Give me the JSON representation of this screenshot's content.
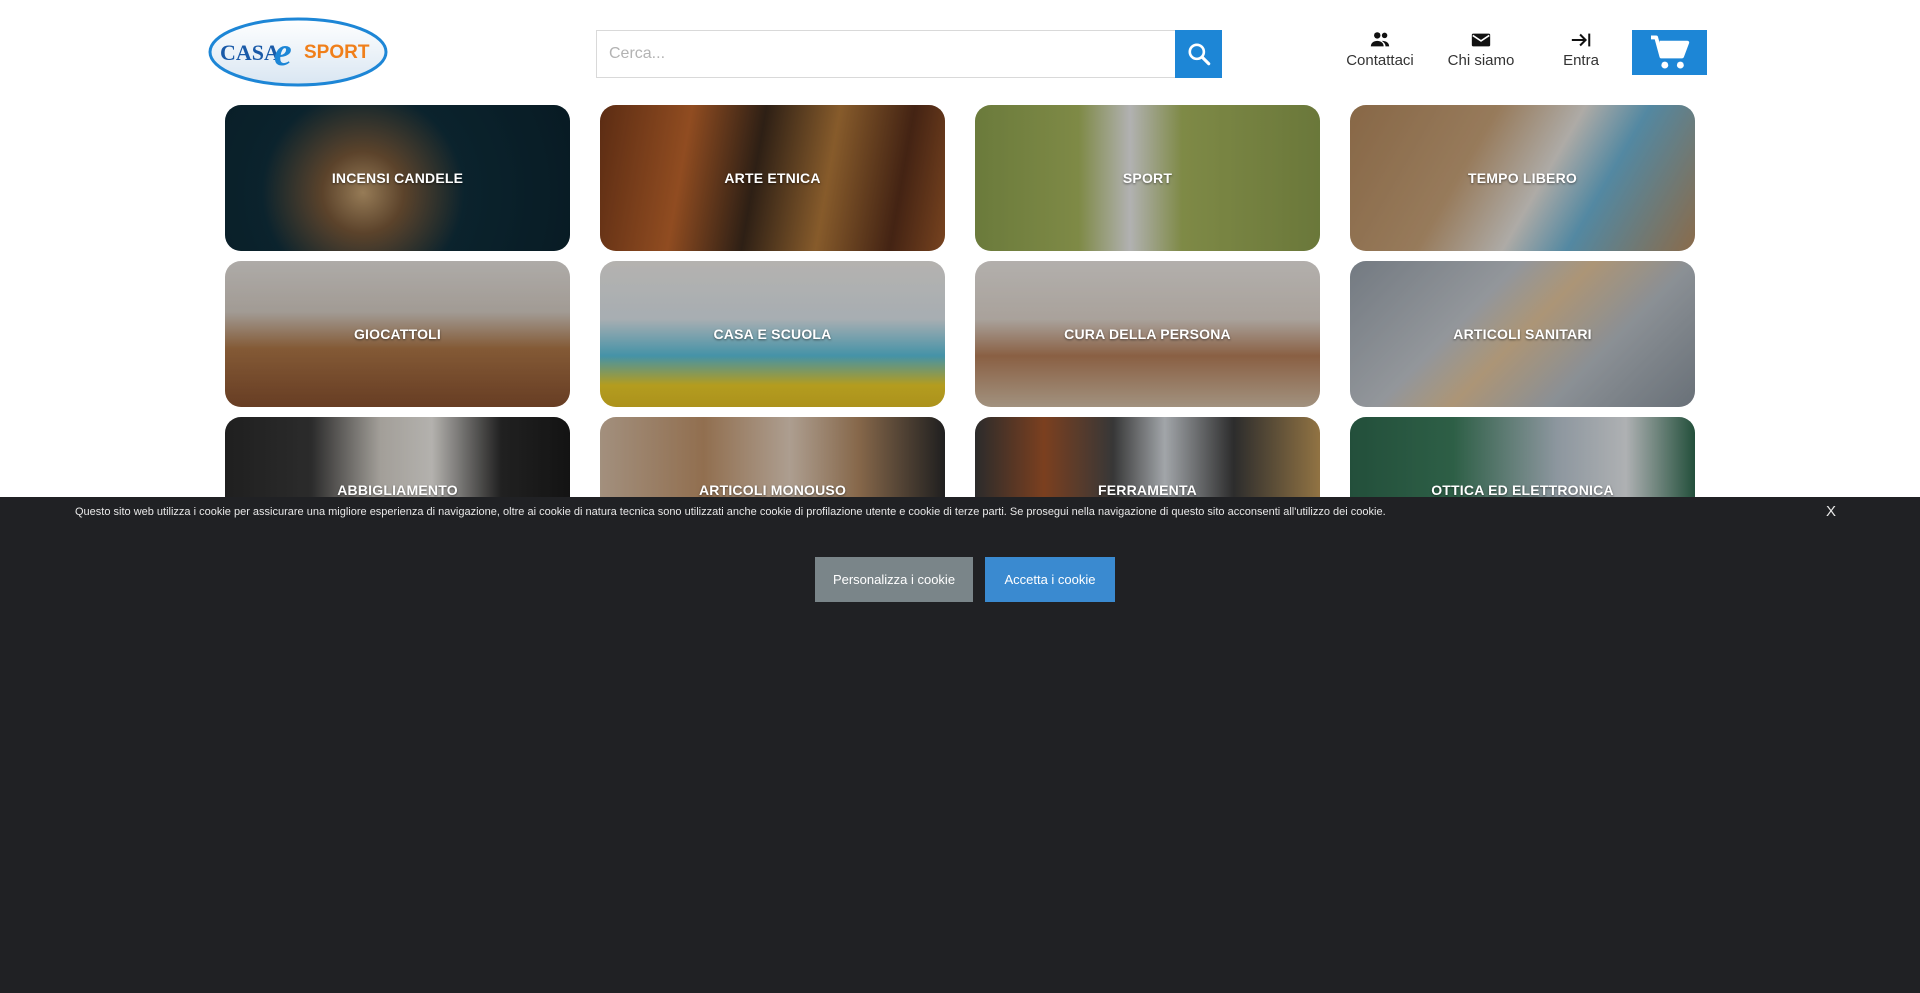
{
  "brand": {
    "logo_text_left": "CASA",
    "logo_text_mid": "e",
    "logo_text_right": "SPORT",
    "primary_color": "#1d86d6",
    "logo_orange": "#f07f1a"
  },
  "search": {
    "placeholder": "Cerca...",
    "icon": "search-icon"
  },
  "nav": {
    "contatti": "Contattaci",
    "chi_siamo": "Chi siamo",
    "entra": "Entra",
    "cart_icon": "cart-icon"
  },
  "categories": [
    {
      "label": "INCENSI CANDELE"
    },
    {
      "label": "ARTE ETNICA"
    },
    {
      "label": "SPORT"
    },
    {
      "label": "TEMPO LIBERO"
    },
    {
      "label": "GIOCATTOLI"
    },
    {
      "label": "CASA E SCUOLA"
    },
    {
      "label": "CURA DELLA PERSONA"
    },
    {
      "label": "ARTICOLI SANITARI"
    },
    {
      "label": "ABBIGLIAMENTO"
    },
    {
      "label": "ARTICOLI MONOUSO"
    },
    {
      "label": "FERRAMENTA"
    },
    {
      "label": "OTTICA ED ELETTRONICA"
    }
  ],
  "cookie": {
    "text": "Questo sito web utilizza i cookie per assicurare una migliore esperienza di navigazione, oltre ai cookie di natura tecnica sono utilizzati anche cookie di profilazione utente e cookie di terze parti. Se prosegui nella navigazione di questo sito acconsenti all'utilizzo dei cookie.",
    "close": "X",
    "customize": "Personalizza i cookie",
    "accept": "Accetta i cookie"
  }
}
